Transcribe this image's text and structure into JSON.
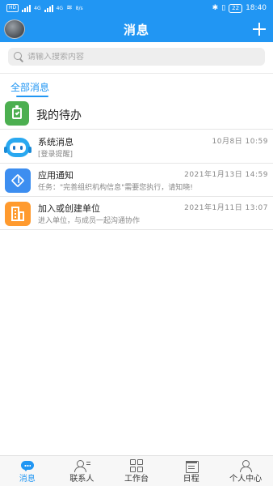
{
  "status_bar": {
    "network_label": "HD",
    "signal_1_label": "4G",
    "signal_2_label": "4G",
    "speed": "8/s",
    "battery": "22",
    "time": "18:40"
  },
  "header": {
    "title": "消息"
  },
  "search": {
    "placeholder": "请输入搜索内容"
  },
  "tabs": {
    "active": "全部消息"
  },
  "todo": {
    "label": "我的待办"
  },
  "messages": [
    {
      "title": "系统消息",
      "time": "10月8日  10:59",
      "subtitle": "[登录提醒]",
      "icon": "robot-icon"
    },
    {
      "title": "应用通知",
      "time": "2021年1月13日  14:59",
      "subtitle": "任务：\"完善组织机构信息\"需要您执行，请知晓!",
      "icon": "cube-icon"
    },
    {
      "title": "加入或创建单位",
      "time": "2021年1月11日  13:07",
      "subtitle": "进入单位，与成员一起沟通协作",
      "icon": "building-icon"
    }
  ],
  "bottom_nav": [
    {
      "label": "消息",
      "icon": "chat-bubble-icon",
      "active": true
    },
    {
      "label": "联系人",
      "icon": "contacts-icon",
      "active": false
    },
    {
      "label": "工作台",
      "icon": "grid-icon",
      "active": false
    },
    {
      "label": "日程",
      "icon": "calendar-icon",
      "active": false
    },
    {
      "label": "个人中心",
      "icon": "person-icon",
      "active": false
    }
  ],
  "colors": {
    "primary": "#2196f3",
    "todo_green": "#4caf50",
    "app_blue": "#3d8ef0",
    "org_orange": "#ff9a2e"
  }
}
